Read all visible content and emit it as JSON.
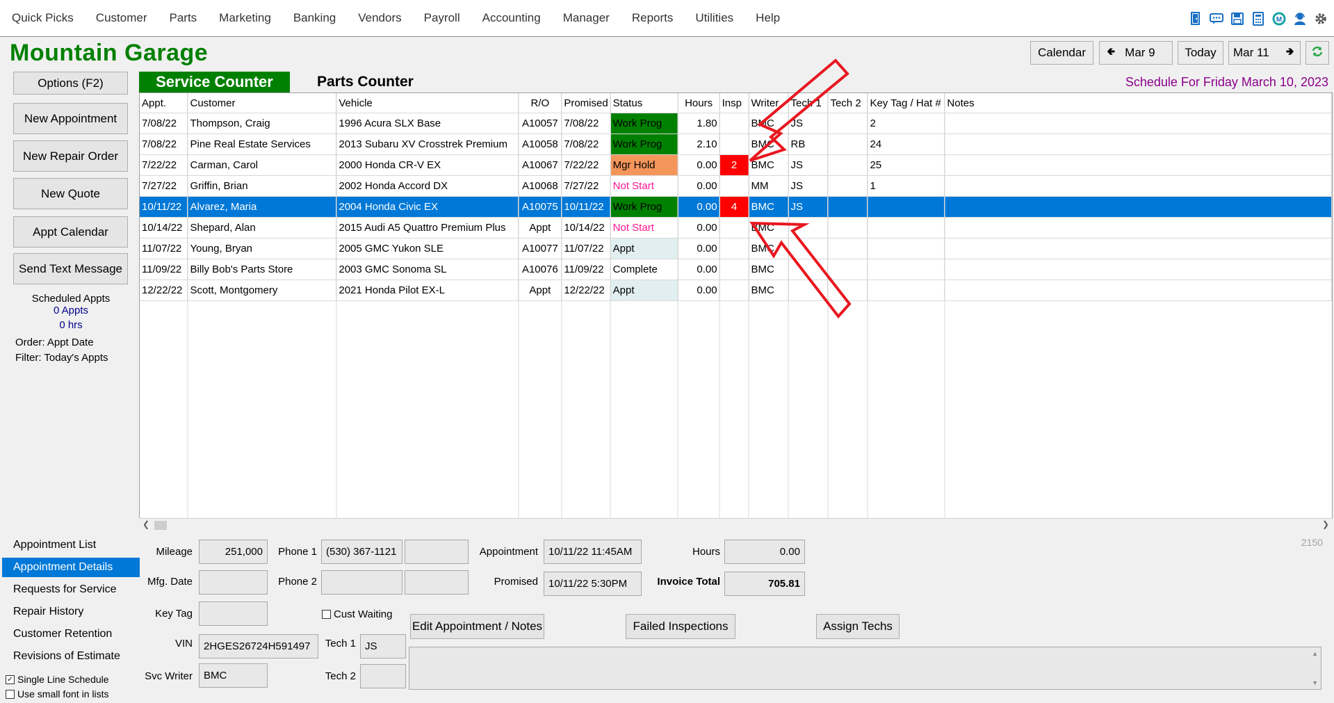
{
  "menu": [
    "Quick Picks",
    "Customer",
    "Parts",
    "Marketing",
    "Banking",
    "Vendors",
    "Payroll",
    "Accounting",
    "Manager",
    "Reports",
    "Utilities",
    "Help"
  ],
  "toolbar_icons": [
    "door-icon",
    "chat-icon",
    "save-icon",
    "calculator-icon",
    "cm-logo-icon",
    "support-icon",
    "gear-icon"
  ],
  "app_title": "Mountain Garage",
  "header_nav": {
    "calendar": "Calendar",
    "prev": "Mar 9",
    "today": "Today",
    "next": "Mar 11"
  },
  "schedule_title": "Schedule For Friday  March 10, 2023",
  "left": {
    "options": "Options (F2)",
    "new_appointment": "New Appointment",
    "new_repair_order": "New Repair Order",
    "new_quote": "New Quote",
    "appt_calendar": "Appt Calendar",
    "send_text": "Send Text Message",
    "scheduled_label": "Scheduled Appts",
    "appts_count": "0 Appts",
    "hrs": "0 hrs",
    "order": "Order: Appt Date",
    "filter": "Filter: Today's Appts"
  },
  "tabs": {
    "service": "Service Counter",
    "parts": "Parts Counter"
  },
  "grid": {
    "columns": [
      "Appt.",
      "Customer",
      "Vehicle",
      "R/O",
      "Promised",
      "Status",
      "Hours",
      "Insp",
      "Writer",
      "Tech 1",
      "Tech 2",
      "Key Tag / Hat #",
      "Notes"
    ],
    "rows": [
      {
        "appt": "7/08/22",
        "customer": "Thompson, Craig",
        "vehicle": "1996 Acura  SLX Base",
        "ro": "A10057",
        "promised": "7/08/22",
        "status": "Work Prog",
        "hours": "1.80",
        "insp": "",
        "writer": "BMC",
        "tech1": "JS",
        "tech2": "",
        "keytag": "2",
        "notes": ""
      },
      {
        "appt": "7/08/22",
        "customer": "Pine Real Estate Services",
        "vehicle": "2013 Subaru  XV Crosstrek Premium",
        "ro": "A10058",
        "promised": "7/08/22",
        "status": "Work Prog",
        "hours": "2.10",
        "insp": "",
        "writer": "BMC",
        "tech1": "RB",
        "tech2": "",
        "keytag": "24",
        "notes": ""
      },
      {
        "appt": "7/22/22",
        "customer": "Carman, Carol",
        "vehicle": "2000 Honda  CR-V EX",
        "ro": "A10067",
        "promised": "7/22/22",
        "status": "Mgr Hold",
        "hours": "0.00",
        "insp": "2",
        "writer": "BMC",
        "tech1": "JS",
        "tech2": "",
        "keytag": "25",
        "notes": ""
      },
      {
        "appt": "7/27/22",
        "customer": "Griffin, Brian",
        "vehicle": "2002 Honda  Accord DX",
        "ro": "A10068",
        "promised": "7/27/22",
        "status": "Not Start",
        "hours": "0.00",
        "insp": "",
        "writer": "MM",
        "tech1": "JS",
        "tech2": "",
        "keytag": "1",
        "notes": ""
      },
      {
        "appt": "10/11/22",
        "customer": "Alvarez, Maria",
        "vehicle": "2004 Honda  Civic EX",
        "ro": "A10075",
        "promised": "10/11/22",
        "status": "Work Prog",
        "hours": "0.00",
        "insp": "4",
        "writer": "BMC",
        "tech1": "JS",
        "tech2": "",
        "keytag": "",
        "notes": ""
      },
      {
        "appt": "10/14/22",
        "customer": "Shepard, Alan",
        "vehicle": "2015 Audi  A5 Quattro Premium Plus",
        "ro": "Appt",
        "promised": "10/14/22",
        "status": "Not Start",
        "hours": "0.00",
        "insp": "",
        "writer": "BMC",
        "tech1": "",
        "tech2": "",
        "keytag": "",
        "notes": ""
      },
      {
        "appt": "11/07/22",
        "customer": "Young, Bryan",
        "vehicle": "2005 GMC  Yukon SLE",
        "ro": "A10077",
        "promised": "11/07/22",
        "status": "Appt",
        "hours": "0.00",
        "insp": "",
        "writer": "BMC",
        "tech1": "",
        "tech2": "",
        "keytag": "",
        "notes": ""
      },
      {
        "appt": "11/09/22",
        "customer": "Billy Bob's Parts Store",
        "vehicle": "2003 GMC  Sonoma SL",
        "ro": "A10076",
        "promised": "11/09/22",
        "status": "Complete",
        "hours": "0.00",
        "insp": "",
        "writer": "BMC",
        "tech1": "",
        "tech2": "",
        "keytag": "",
        "notes": ""
      },
      {
        "appt": "12/22/22",
        "customer": "Scott, Montgomery",
        "vehicle": "2021 Honda  Pilot EX-L",
        "ro": "Appt",
        "promised": "12/22/22",
        "status": "Appt",
        "hours": "0.00",
        "insp": "",
        "writer": "BMC",
        "tech1": "",
        "tech2": "",
        "keytag": "",
        "notes": ""
      }
    ],
    "selected_row": 4
  },
  "nav": [
    "Appointment List",
    "Appointment Details",
    "Requests for Service",
    "Repair History",
    "Customer Retention",
    "Revisions of Estimate"
  ],
  "nav_active": 1,
  "checks": {
    "single_line": "Single Line Schedule",
    "small_font": "Use small font in lists"
  },
  "details": {
    "mileage_label": "Mileage",
    "mileage": "251,000",
    "mfg_label": "Mfg. Date",
    "mfg": "",
    "keytag_label": "Key Tag",
    "keytag": "",
    "vin_label": "VIN",
    "vin": "2HGES26724H591497",
    "writer_label": "Svc Writer",
    "writer": "BMC",
    "phone1_label": "Phone 1",
    "phone1": "(530) 367-1121",
    "phone2_label": "Phone 2",
    "phone2": "",
    "cust_waiting": "Cust Waiting",
    "tech1_label": "Tech 1",
    "tech1": "JS",
    "tech2_label": "Tech 2",
    "tech2": "",
    "appointment_label": "Appointment",
    "appointment": "10/11/22 11:45AM",
    "promised_label": "Promised",
    "promised": "10/11/22  5:30PM",
    "hours_label": "Hours",
    "hours": "0.00",
    "invoice_label": "Invoice Total",
    "invoice": "705.81",
    "edit_btn": "Edit Appointment / Notes",
    "failed_btn": "Failed Inspections",
    "assign_btn": "Assign Techs",
    "record_num": "2150"
  },
  "colors": {
    "brand_green": "#008000",
    "selection_blue": "#0078d7",
    "insp_red": "#ff0000",
    "mgr_hold": "#f4955a",
    "not_start": "#ff1493",
    "schedule_title": "#8b008b",
    "annotation_arrow": "#e8171f"
  }
}
